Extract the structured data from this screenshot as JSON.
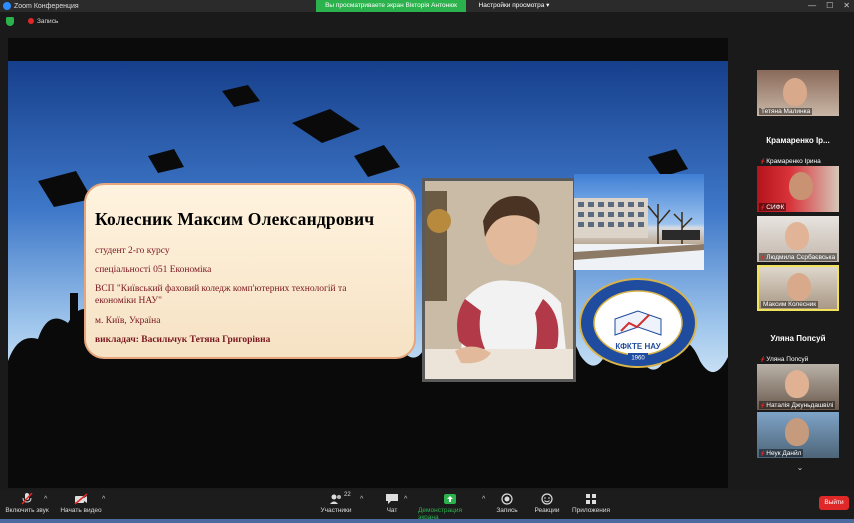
{
  "window": {
    "title": "Zoom Конференция"
  },
  "banner": {
    "viewing_text": "Вы просматриваете экран Вікторія Антонюк",
    "view_options": "Настройки просмотра"
  },
  "infobar": {
    "recording_label": "Запись"
  },
  "slide": {
    "name": "Колесник Максим Олександрович",
    "lines": [
      "студент 2-го курсу",
      "спеціальності 051 Економіка",
      "ВСП \"Київський фаховий коледж комп'ютерних технологій та",
      "економіки НАУ\"",
      "м. Київ, Україна",
      "викладач: Васильчук Тетяна Григорівна"
    ],
    "logo_text": "КФКТЕ НАУ",
    "logo_year": "1960"
  },
  "participants": {
    "tiles": [
      {
        "label": "Тетяна Малинка",
        "type": "video",
        "muted": false
      },
      {
        "center_name": "Крамаренко Ір...",
        "label": "Крамаренко Ірина",
        "type": "name",
        "muted": true
      },
      {
        "label": "СИФК",
        "type": "video",
        "muted": true
      },
      {
        "label": "Людмила Сєрбаєвська",
        "type": "video",
        "muted": true
      },
      {
        "label": "Максим Колесник",
        "type": "video",
        "muted": false
      },
      {
        "center_name": "Уляна Попсуй",
        "label": "Уляна Попсуй",
        "type": "name",
        "muted": true
      },
      {
        "label": "Наталія Джуньдашвілі",
        "type": "video",
        "muted": true
      },
      {
        "label": "Неук Данйл",
        "type": "video",
        "muted": true
      }
    ]
  },
  "toolbar": {
    "unmute": "Включить звук",
    "start_video": "Начать видео",
    "participants": "Участники",
    "participants_count": "22",
    "chat": "Чат",
    "share_screen": "Демонстрация экрана",
    "record": "Запись",
    "reactions": "Реакции",
    "apps": "Приложения",
    "end": "Выйти"
  },
  "colors": {
    "accent_green": "#2bb24c",
    "end_red": "#e02828",
    "card_text": "#7a1620"
  }
}
